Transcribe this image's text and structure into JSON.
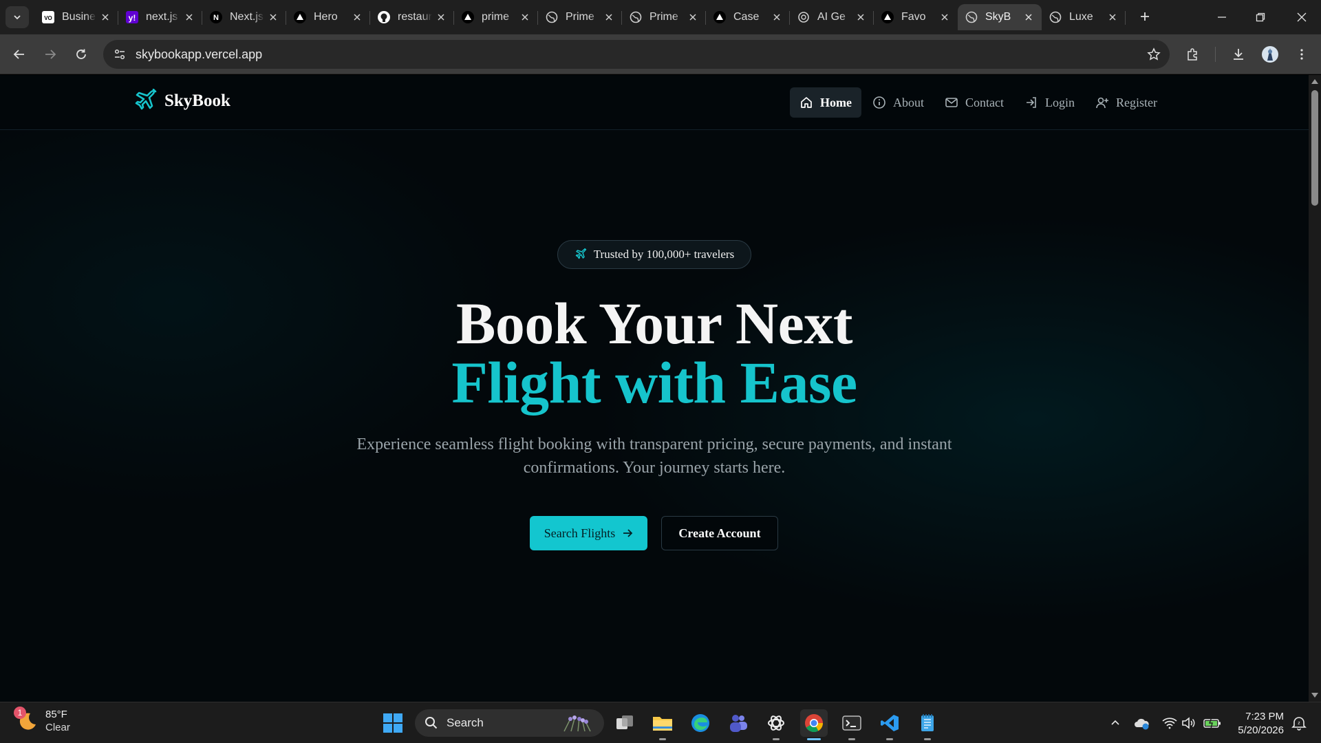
{
  "browser": {
    "tabs": [
      {
        "title": "Business",
        "icon": "vo-logo-icon"
      },
      {
        "title": "next.js",
        "icon": "yahoo-icon"
      },
      {
        "title": "Next.js",
        "icon": "notion-icon"
      },
      {
        "title": "Hero",
        "icon": "triangle-logo-icon"
      },
      {
        "title": "restaurant",
        "icon": "github-icon"
      },
      {
        "title": "prime",
        "icon": "triangle-logo-icon"
      },
      {
        "title": "Prime",
        "icon": "globe-icon"
      },
      {
        "title": "Prime",
        "icon": "globe-icon"
      },
      {
        "title": "Case",
        "icon": "triangle-logo-icon"
      },
      {
        "title": "AI Ge",
        "icon": "openai-icon"
      },
      {
        "title": "Favo",
        "icon": "triangle-logo-icon"
      },
      {
        "title": "SkyB",
        "icon": "globe-icon",
        "active": true
      },
      {
        "title": "Luxe",
        "icon": "globe-icon"
      }
    ],
    "url": "skybookapp.vercel.app"
  },
  "site": {
    "brand": "SkyBook",
    "nav": [
      {
        "label": "Home",
        "icon": "home-icon",
        "active": true
      },
      {
        "label": "About",
        "icon": "info-icon"
      },
      {
        "label": "Contact",
        "icon": "mail-icon"
      },
      {
        "label": "Login",
        "icon": "login-icon"
      },
      {
        "label": "Register",
        "icon": "user-plus-icon"
      }
    ],
    "hero": {
      "badge": "Trusted by 100,000+ travelers",
      "headline_line1": "Book Your Next",
      "headline_line2": "Flight with Ease",
      "subtext": "Experience seamless flight booking with transparent pricing, secure payments, and instant confirmations. Your journey starts here.",
      "primary_cta": "Search Flights",
      "secondary_cta": "Create Account"
    },
    "colors": {
      "accent": "#16c4cc",
      "background": "#03080b"
    }
  },
  "taskbar": {
    "weather": {
      "temp": "85°F",
      "condition": "Clear",
      "badge": "1"
    },
    "search_label": "Search",
    "clock": {
      "time": "7:23 PM",
      "date": "5/20/2026"
    }
  }
}
